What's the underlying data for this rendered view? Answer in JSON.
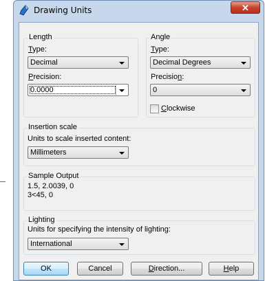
{
  "window": {
    "title": "Drawing Units",
    "close_glyph": "✕"
  },
  "length": {
    "group_label": "Length",
    "type_label_u": "T",
    "type_label_rest": "ype:",
    "type_value": "Decimal",
    "precision_label_u": "P",
    "precision_label_rest": "recision:",
    "precision_value": "0.0000"
  },
  "angle": {
    "group_label": "Angle",
    "type_label_u": "T",
    "type_label_rest": "ype:",
    "type_value": "Decimal Degrees",
    "precision_label_pre": "Precisio",
    "precision_label_u": "n",
    "precision_label_post": ":",
    "precision_value": "0",
    "clockwise_u": "C",
    "clockwise_rest": "lockwise",
    "clockwise_checked": false
  },
  "insertion": {
    "group_label": "Insertion scale",
    "description": "Units to scale inserted content:",
    "value": "Millimeters"
  },
  "sample": {
    "group_label": "Sample Output",
    "line1": "1.5, 2.0039, 0",
    "line2": "3<45, 0"
  },
  "lighting": {
    "group_label": "Lighting",
    "description": "Units for specifying the intensity of lighting:",
    "value": "International"
  },
  "buttons": {
    "ok": "OK",
    "cancel": "Cancel",
    "direction_u": "D",
    "direction_rest": "irection...",
    "help_u": "H",
    "help_rest": "elp"
  },
  "colors": {
    "frame": "#c7d8ec",
    "client": "#f0f0f0",
    "close": "#c7432c",
    "default_button": "#3c7fb1"
  }
}
